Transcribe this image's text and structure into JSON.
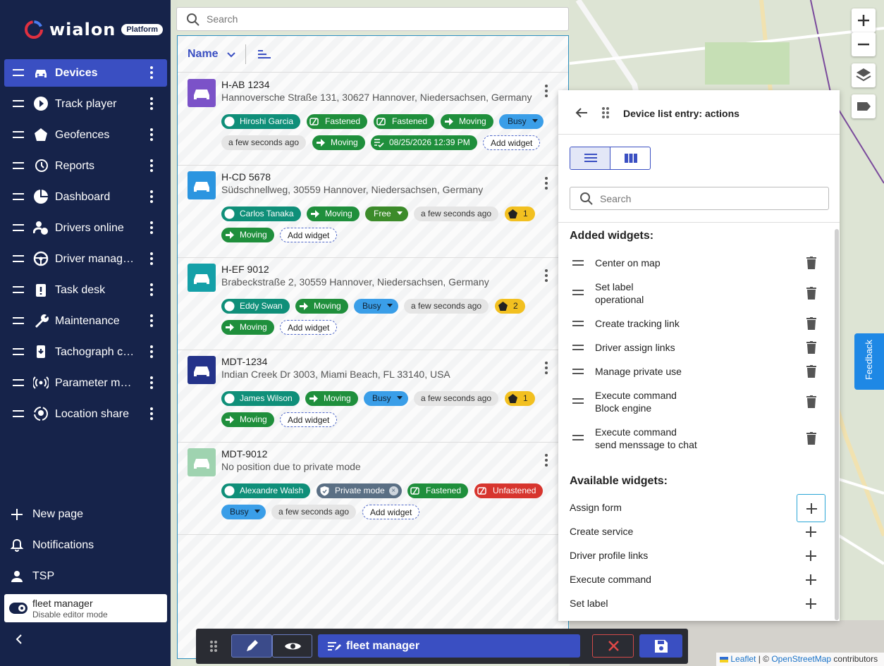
{
  "brand": {
    "name": "wialon",
    "badge": "Platform"
  },
  "colors": {
    "sidebar": "#16234a",
    "accent": "#3a4fc2",
    "teal": "#0f8f79",
    "green": "#1f8f3c"
  },
  "nav": {
    "items": [
      {
        "label": "Devices",
        "icon": "car-icon",
        "active": true
      },
      {
        "label": "Track player",
        "icon": "play-icon"
      },
      {
        "label": "Geofences",
        "icon": "pentagon-icon"
      },
      {
        "label": "Reports",
        "icon": "history-icon"
      },
      {
        "label": "Dashboard",
        "icon": "pie-chart-icon"
      },
      {
        "label": "Drivers online",
        "icon": "driver-online-icon"
      },
      {
        "label": "Driver manag…",
        "icon": "steering-wheel-icon"
      },
      {
        "label": "Task desk",
        "icon": "clipboard-alert-icon"
      },
      {
        "label": "Maintenance",
        "icon": "wrench-icon"
      },
      {
        "label": "Tachograph c…",
        "icon": "tachograph-card-icon"
      },
      {
        "label": "Parameter m…",
        "icon": "signal-icon"
      },
      {
        "label": "Location share",
        "icon": "location-share-icon"
      }
    ],
    "new_page": "New page",
    "notifications": "Notifications",
    "tsp": "TSP",
    "editor": {
      "title": "fleet manager",
      "subtitle": "Disable editor mode"
    }
  },
  "search": {
    "placeholder": "Search"
  },
  "list": {
    "sort_label": "Name",
    "devices": [
      {
        "name": "H-AB 1234",
        "address": "Hannoversche Straße 131, 30627 Hannover, Niedersachsen, Germany",
        "avatar_color": "#7b52c8",
        "row1": [
          {
            "t": "Hiroshi Garcia",
            "c": "teal",
            "i": "steering-wheel-icon"
          },
          {
            "t": "Fastened",
            "c": "green",
            "i": "seatbelt-icon"
          },
          {
            "t": "Fastened",
            "c": "green",
            "i": "seatbelt-icon"
          },
          {
            "t": "Moving",
            "c": "green",
            "i": "arrow-right-icon"
          },
          {
            "t": "Busy",
            "c": "blue"
          }
        ],
        "row2": [
          {
            "t": "a few seconds ago",
            "c": "grey"
          },
          {
            "t": "Moving",
            "c": "green",
            "i": "arrow-right-icon"
          },
          {
            "t": "08/25/2026 12:39 PM",
            "c": "green",
            "i": "checklist-icon"
          },
          {
            "t": "Add widget",
            "c": "dashed"
          }
        ]
      },
      {
        "name": "H-CD 5678",
        "address": "Südschnellweg, 30559 Hannover, Niedersachsen, Germany",
        "avatar_color": "#2b95e0",
        "row1": [
          {
            "t": "Carlos Tanaka",
            "c": "teal",
            "i": "steering-wheel-icon"
          },
          {
            "t": "Moving",
            "c": "green",
            "i": "arrow-right-icon"
          },
          {
            "t": "Free",
            "c": "olive"
          },
          {
            "t": "a few seconds ago",
            "c": "grey"
          },
          {
            "t": "1",
            "c": "yellow",
            "i": "pentagon-icon"
          }
        ],
        "row2": [
          {
            "t": "Moving",
            "c": "green",
            "i": "arrow-right-icon"
          },
          {
            "t": "Add widget",
            "c": "dashed"
          }
        ]
      },
      {
        "name": "H-EF 9012",
        "address": "Brabeckstraße 2, 30559 Hannover, Niedersachsen, Germany",
        "avatar_color": "#14a0a8",
        "row1": [
          {
            "t": "Eddy Swan",
            "c": "teal",
            "i": "steering-wheel-icon"
          },
          {
            "t": "Moving",
            "c": "green",
            "i": "arrow-right-icon"
          },
          {
            "t": "Busy",
            "c": "blue"
          },
          {
            "t": "a few seconds ago",
            "c": "grey"
          },
          {
            "t": "2",
            "c": "yellow",
            "i": "pentagon-icon"
          }
        ],
        "row2": [
          {
            "t": "Moving",
            "c": "green",
            "i": "arrow-right-icon"
          },
          {
            "t": "Add widget",
            "c": "dashed"
          }
        ]
      },
      {
        "name": "MDT-1234",
        "address": "Indian Creek Dr 3003, Miami Beach, FL 33140, USA",
        "avatar_color": "#24338a",
        "row1": [
          {
            "t": "James Wilson",
            "c": "teal",
            "i": "steering-wheel-icon"
          },
          {
            "t": "Moving",
            "c": "green",
            "i": "arrow-right-icon"
          },
          {
            "t": "Busy",
            "c": "blue"
          },
          {
            "t": "a few seconds ago",
            "c": "grey"
          },
          {
            "t": "1",
            "c": "yellow",
            "i": "pentagon-icon"
          }
        ],
        "row2": [
          {
            "t": "Moving",
            "c": "green",
            "i": "arrow-right-icon"
          },
          {
            "t": "Add widget",
            "c": "dashed"
          }
        ]
      },
      {
        "name": "MDT-9012",
        "address": "No position due to private mode",
        "avatar_color": "#9fd3b0",
        "row1": [
          {
            "t": "Alexandre Walsh",
            "c": "teal",
            "i": "steering-wheel-icon"
          },
          {
            "t": "Private mode",
            "c": "slate",
            "i": "shield-icon"
          },
          {
            "t": "Fastened",
            "c": "green",
            "i": "seatbelt-icon"
          },
          {
            "t": "Unfastened",
            "c": "red",
            "i": "seatbelt-icon"
          }
        ],
        "row2": [
          {
            "t": "Busy",
            "c": "blue"
          },
          {
            "t": "a few seconds ago",
            "c": "grey"
          },
          {
            "t": "Add widget",
            "c": "dashed"
          }
        ]
      }
    ]
  },
  "actions": {
    "title": "Device list entry: actions",
    "search_placeholder": "Search",
    "added_title": "Added widgets:",
    "added": [
      [
        "Center on map",
        ""
      ],
      [
        "Set label",
        "operational"
      ],
      [
        "Create tracking link",
        ""
      ],
      [
        "Driver assign links",
        ""
      ],
      [
        "Manage private use",
        ""
      ],
      [
        "Execute command",
        "Block engine"
      ],
      [
        "Execute command",
        "send menssage to chat"
      ]
    ],
    "available_title": "Available widgets:",
    "available": [
      "Assign form",
      "Create service",
      "Driver profile links",
      "Execute command",
      "Set label"
    ]
  },
  "map": {
    "feedback": "Feedback",
    "attrib_leaflet": "Leaflet",
    "attrib_sep": " | © ",
    "attrib_osm": "OpenStreetMap",
    "attrib_tail": " contributors"
  },
  "toolbar": {
    "title": "fleet manager"
  }
}
